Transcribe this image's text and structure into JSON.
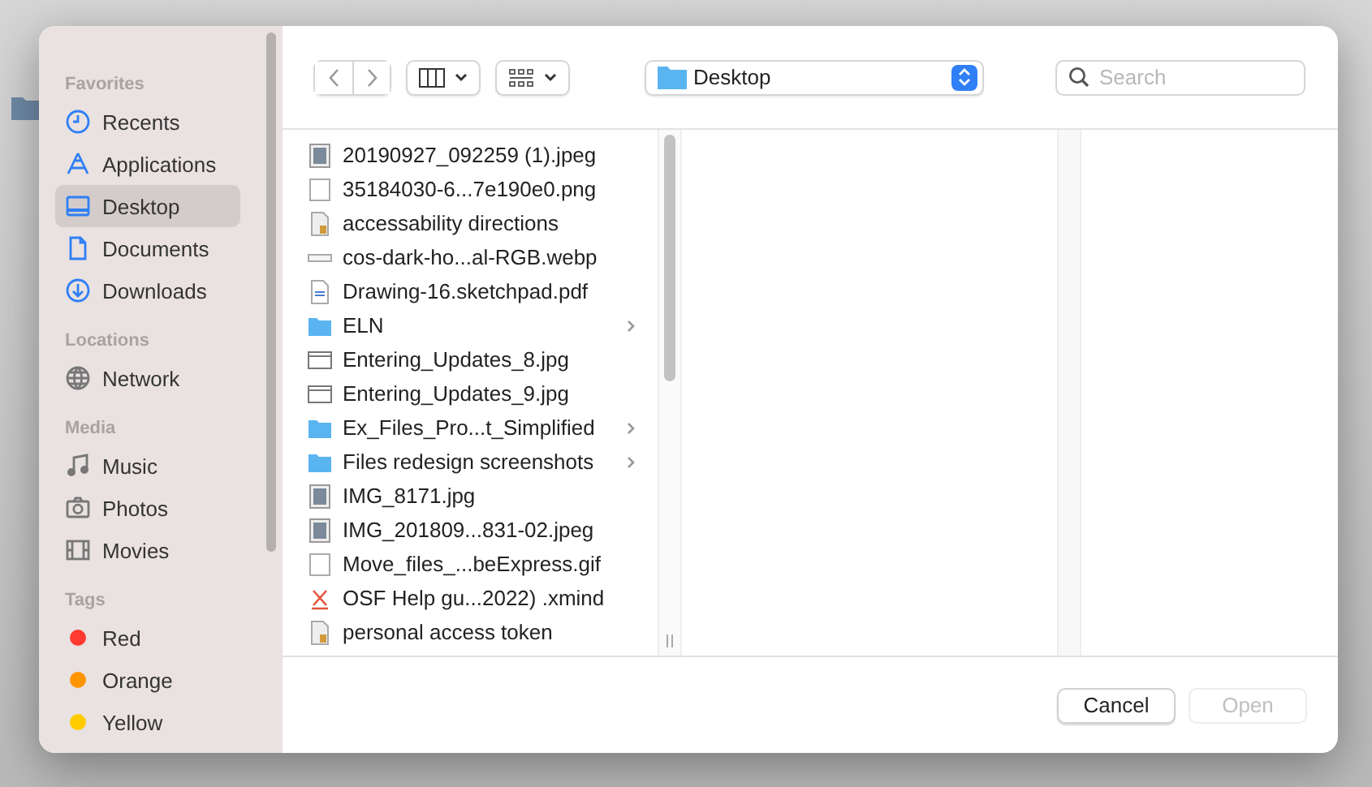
{
  "sidebar": {
    "sections": [
      {
        "title": "Favorites",
        "items": [
          {
            "label": "Recents",
            "selected": false
          },
          {
            "label": "Applications",
            "selected": false
          },
          {
            "label": "Desktop",
            "selected": true
          },
          {
            "label": "Documents",
            "selected": false
          },
          {
            "label": "Downloads",
            "selected": false
          }
        ]
      },
      {
        "title": "Locations",
        "items": [
          {
            "label": "Network",
            "selected": false
          }
        ]
      },
      {
        "title": "Media",
        "items": [
          {
            "label": "Music",
            "selected": false
          },
          {
            "label": "Photos",
            "selected": false
          },
          {
            "label": "Movies",
            "selected": false
          }
        ]
      },
      {
        "title": "Tags",
        "items": [
          {
            "label": "Red",
            "color": "#ff3b30",
            "selected": false
          },
          {
            "label": "Orange",
            "color": "#ff9500",
            "selected": false
          },
          {
            "label": "Yellow",
            "color": "#ffcc00",
            "selected": false
          }
        ]
      }
    ]
  },
  "toolbar": {
    "location": "Desktop",
    "search": {
      "placeholder": "Search"
    }
  },
  "files": [
    {
      "name": "20190927_092259 (1).jpeg",
      "kind": "photo",
      "expandable": false
    },
    {
      "name": "35184030-6...7e190e0.png",
      "kind": "blank",
      "expandable": false
    },
    {
      "name": "accessability directions",
      "kind": "package",
      "expandable": false
    },
    {
      "name": "cos-dark-ho...al-RGB.webp",
      "kind": "strip",
      "expandable": false
    },
    {
      "name": "Drawing-16.sketchpad.pdf",
      "kind": "pdf",
      "expandable": false
    },
    {
      "name": "ELN",
      "kind": "folder",
      "expandable": true
    },
    {
      "name": "Entering_Updates_8.jpg",
      "kind": "window",
      "expandable": false
    },
    {
      "name": "Entering_Updates_9.jpg",
      "kind": "window",
      "expandable": false
    },
    {
      "name": "Ex_Files_Pro...t_Simplified",
      "kind": "folder",
      "expandable": true
    },
    {
      "name": "Files redesign screenshots",
      "kind": "folder",
      "expandable": true
    },
    {
      "name": "IMG_8171.jpg",
      "kind": "photo",
      "expandable": false
    },
    {
      "name": "IMG_201809...831-02.jpeg",
      "kind": "photo",
      "expandable": false
    },
    {
      "name": "Move_files_...beExpress.gif",
      "kind": "blank",
      "expandable": false
    },
    {
      "name": "OSF Help gu...2022) .xmind",
      "kind": "xmind",
      "expandable": false
    },
    {
      "name": "personal access token",
      "kind": "package",
      "expandable": false
    }
  ],
  "buttons": [
    {
      "label": "Cancel",
      "disabled": false
    },
    {
      "label": "Open",
      "disabled": true
    }
  ]
}
